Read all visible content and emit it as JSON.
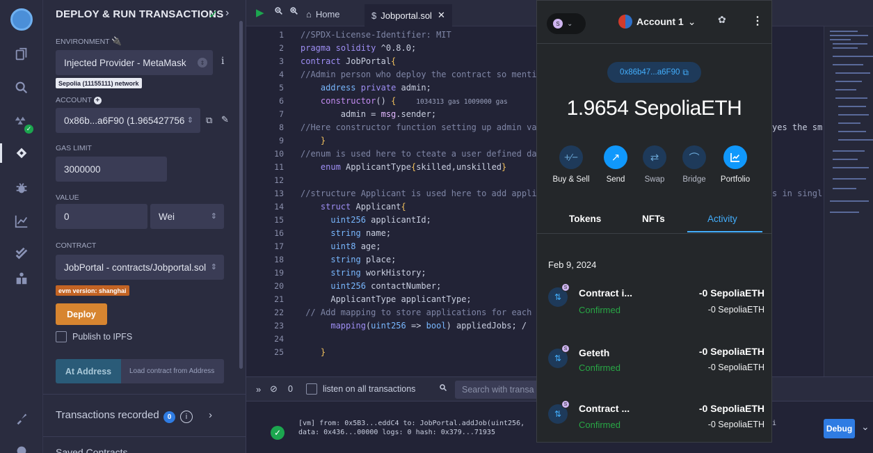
{
  "panel": {
    "title": "DEPLOY & RUN TRANSACTIONS",
    "environment_label": "ENVIRONMENT",
    "environment_value": "Injected Provider - MetaMask",
    "network_chip": "Sepolia (11155111) network",
    "account_label": "ACCOUNT",
    "account_value": "0x86b...a6F90 (1.965427756",
    "gas_limit_label": "GAS LIMIT",
    "gas_limit_value": "3000000",
    "value_label": "VALUE",
    "value_amount": "0",
    "value_unit": "Wei",
    "contract_label": "CONTRACT",
    "contract_value": "JobPortal - contracts/Jobportal.sol",
    "evm_chip": "evm version: shanghai",
    "deploy_label": "Deploy",
    "publish_label": "Publish to IPFS",
    "at_address_label": "At Address",
    "load_contract_placeholder": "Load contract from Address",
    "transactions_recorded_label": "Transactions recorded",
    "transactions_recorded_count": "0",
    "saved_contracts_label": "Saved Contracts"
  },
  "topbar": {
    "home_tab": "Home",
    "file_tab": "Jobportal.sol"
  },
  "editor": {
    "line_numbers": [
      "1",
      "2",
      "3",
      "4",
      "5",
      "6",
      "7",
      "8",
      "9",
      "10",
      "11",
      "12",
      "13",
      "14",
      "15",
      "16",
      "17",
      "18",
      "19",
      "20",
      "21",
      "22",
      "23",
      "24",
      "25"
    ],
    "gas_hint": "1034313 gas 1009000 gas",
    "overflow_8": "yes the sm",
    "overflow_13": "s in singl"
  },
  "terminal": {
    "listen_label": "listen on all transactions",
    "count": "0",
    "search_placeholder": "Search with transa",
    "log_line1": "[vm] from: 0x5B3...eddC4 to: JobPortal.addJob(uint256,",
    "log_line2": "data: 0x436...00000 logs: 0 hash: 0x379...71935",
    "log_tail": "i",
    "debug_label": "Debug"
  },
  "metamask": {
    "account_name": "Account 1",
    "address": "0x86b47...a6F90",
    "balance": "1.9654 SepoliaETH",
    "actions": [
      "Buy & Sell",
      "Send",
      "Swap",
      "Bridge",
      "Portfolio"
    ],
    "tabs": [
      "Tokens",
      "NFTs",
      "Activity"
    ],
    "date": "Feb 9, 2024",
    "transactions": [
      {
        "name": "Contract i...",
        "status": "Confirmed",
        "amount": "-0 SepoliaETH",
        "amount_fiat": "-0 SepoliaETH"
      },
      {
        "name": "Geteth",
        "status": "Confirmed",
        "amount": "-0 SepoliaETH",
        "amount_fiat": "-0 SepoliaETH"
      },
      {
        "name": "Contract ...",
        "status": "Confirmed",
        "amount": "-0 SepoliaETH",
        "amount_fiat": "-0 SepoliaETH"
      }
    ]
  },
  "colors": {
    "accent_blue": "#1098fc",
    "deploy_orange": "#d78530",
    "confirmed_green": "#28a745"
  }
}
